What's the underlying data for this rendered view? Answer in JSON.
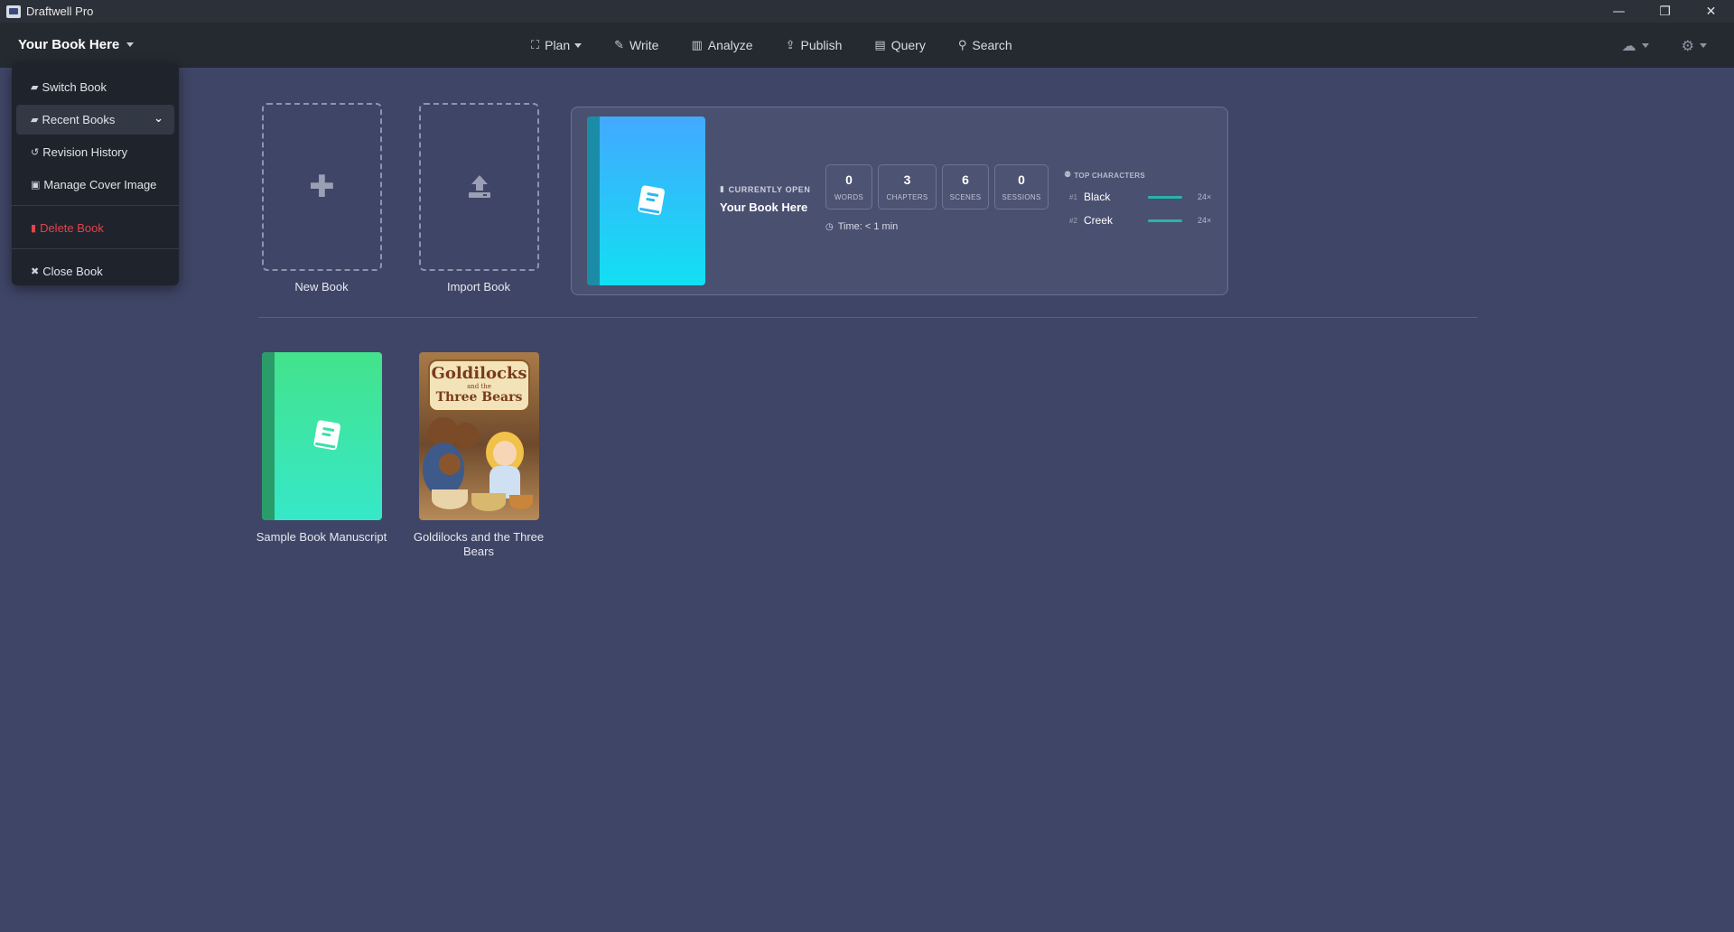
{
  "window": {
    "title": "Draftwell Pro",
    "controls": {
      "minimize": "—",
      "restore": "❐",
      "close": "✕"
    }
  },
  "menubar": {
    "book_title": "Your Book Here",
    "nav": [
      {
        "label": "Plan",
        "icon": "sitemap-icon",
        "glyph": "⛶",
        "has_caret": true
      },
      {
        "label": "Write",
        "icon": "pencil-icon",
        "glyph": "✎",
        "has_caret": false
      },
      {
        "label": "Analyze",
        "icon": "bar-chart-icon",
        "glyph": "▥",
        "has_caret": false
      },
      {
        "label": "Publish",
        "icon": "upload-icon",
        "glyph": "⇪",
        "has_caret": false
      },
      {
        "label": "Query",
        "icon": "table-icon",
        "glyph": "▤",
        "has_caret": false
      },
      {
        "label": "Search",
        "icon": "search-icon",
        "glyph": "⚲",
        "has_caret": false
      }
    ],
    "tools": [
      {
        "icon": "cloud-icon",
        "glyph": "☁"
      },
      {
        "icon": "gear-icon",
        "glyph": "⚙"
      }
    ]
  },
  "dropdown": {
    "items": [
      {
        "label": "Switch Book",
        "icon": "book-icon",
        "glyph": "▰"
      },
      {
        "label": "Recent Books",
        "icon": "book-icon",
        "glyph": "▰",
        "expand": "⌄"
      },
      {
        "label": "Revision History",
        "icon": "history-icon",
        "glyph": "↺"
      },
      {
        "label": "Manage Cover Image",
        "icon": "image-icon",
        "glyph": "▣"
      }
    ],
    "delete": {
      "label": "Delete Book",
      "icon": "trash-icon",
      "glyph": "▮"
    },
    "close": {
      "label": "Close Book",
      "icon": "close-icon",
      "glyph": "✖"
    }
  },
  "actions": {
    "new_book": "New Book",
    "import_book": "Import Book"
  },
  "current": {
    "label": "CURRENTLY OPEN",
    "title": "Your Book Here",
    "stats": [
      {
        "value": "0",
        "label": "WORDS"
      },
      {
        "value": "3",
        "label": "CHAPTERS"
      },
      {
        "value": "6",
        "label": "SCENES"
      },
      {
        "value": "0",
        "label": "SESSIONS"
      }
    ],
    "time": "Time: < 1 min",
    "top_characters_label": "TOP CHARACTERS",
    "top_characters": [
      {
        "rank": "#1",
        "name": "Black",
        "count": "24×",
        "share": 1.0
      },
      {
        "rank": "#2",
        "name": "Creek",
        "count": "24×",
        "share": 1.0
      }
    ]
  },
  "library": [
    {
      "title": "Sample Book Manuscript",
      "cover": "green"
    },
    {
      "title": "Goldilocks and the Three Bears",
      "cover": "image",
      "cover_text": {
        "line1": "Goldilocks",
        "line2": "and the",
        "line3": "Three Bears"
      }
    }
  ],
  "colors": {
    "background": "#3f4566",
    "menubar": "#252a31",
    "accent_teal": "#2ab3a8",
    "danger": "#e0444e"
  }
}
